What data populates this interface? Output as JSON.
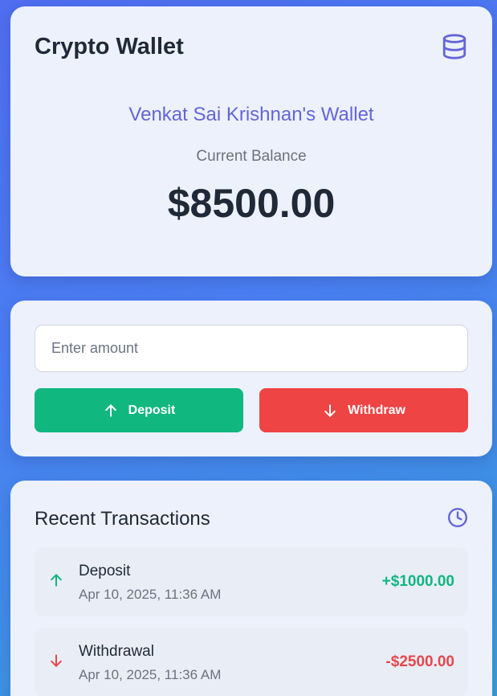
{
  "wallet": {
    "title": "Crypto Wallet",
    "icon": "database-icon",
    "owner_name": "Venkat Sai Krishnan's Wallet",
    "balance_label": "Current Balance",
    "balance_value": "$8500.00"
  },
  "actions": {
    "amount_placeholder": "Enter amount",
    "amount_value": "",
    "deposit_label": "Deposit",
    "deposit_icon": "arrow-up-icon",
    "withdraw_label": "Withdraw",
    "withdraw_icon": "arrow-down-icon"
  },
  "transactions": {
    "title": "Recent Transactions",
    "icon": "clock-icon",
    "items": [
      {
        "type": "Deposit",
        "date": "Apr 10, 2025, 11:36 AM",
        "amount": "+$1000.00",
        "direction": "in"
      },
      {
        "type": "Withdrawal",
        "date": "Apr 10, 2025, 11:36 AM",
        "amount": "-$2500.00",
        "direction": "out"
      }
    ]
  },
  "colors": {
    "accent": "#6366d6",
    "deposit": "#10b77f",
    "withdraw": "#ef4444",
    "text_primary": "#1f2937",
    "text_muted": "#6b7280"
  }
}
